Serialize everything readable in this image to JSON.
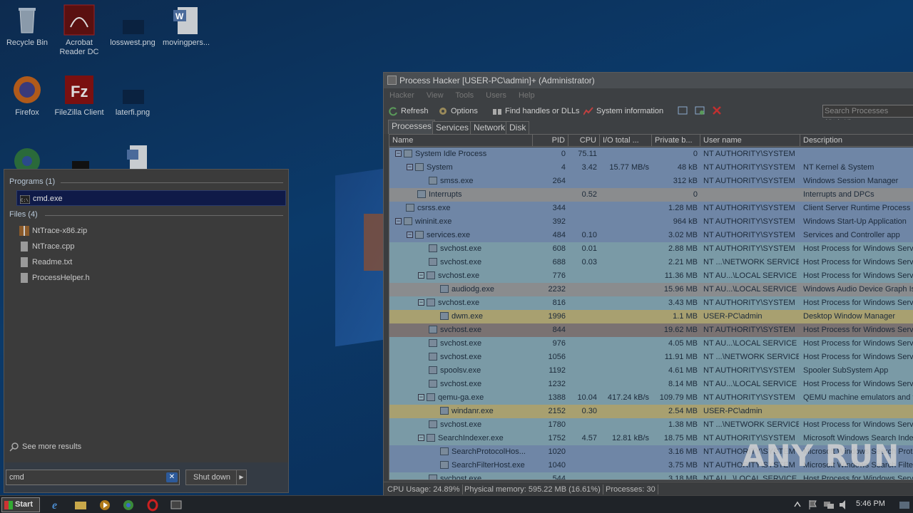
{
  "desktop": {
    "icons": [
      {
        "label": "Recycle Bin",
        "icon": "recycle-bin-icon"
      },
      {
        "label": "Acrobat Reader DC",
        "icon": "acrobat-icon"
      },
      {
        "label": "losswest.png",
        "icon": "image-file-icon"
      },
      {
        "label": "movingpers...",
        "icon": "word-doc-icon"
      },
      {
        "label": "Firefox",
        "icon": "firefox-icon"
      },
      {
        "label": "FileZilla Client",
        "icon": "filezilla-icon"
      },
      {
        "label": "laterfi.png",
        "icon": "image-file-icon"
      }
    ]
  },
  "start_menu": {
    "programs_header": "Programs (1)",
    "programs": [
      {
        "label": "cmd.exe",
        "icon": "cmd-icon"
      }
    ],
    "files_header": "Files (4)",
    "files": [
      {
        "label": "NtTrace-x86.zip",
        "icon": "zip-icon"
      },
      {
        "label": "NtTrace.cpp",
        "icon": "file-icon"
      },
      {
        "label": "Readme.txt",
        "icon": "file-icon"
      },
      {
        "label": "ProcessHelper.h",
        "icon": "file-icon"
      }
    ],
    "see_more": "See more results",
    "search_value": "cmd",
    "shutdown_label": "Shut down"
  },
  "process_hacker": {
    "title": "Process Hacker [USER-PC\\admin]+ (Administrator)",
    "menu": [
      "Hacker",
      "View",
      "Tools",
      "Users",
      "Help"
    ],
    "toolbar": {
      "refresh": "Refresh",
      "options": "Options",
      "find_handles": "Find handles or DLLs",
      "system_info": "System information",
      "search_placeholder": "Search Processes (Ctrl+K)"
    },
    "tabs": [
      "Processes",
      "Services",
      "Network",
      "Disk"
    ],
    "columns": [
      "Name",
      "PID",
      "CPU",
      "I/O total ...",
      "Private b...",
      "User name",
      "Description"
    ],
    "rows": [
      {
        "name": "System Idle Process",
        "pid": "0",
        "cpu": "75.11",
        "io": "",
        "priv": "0",
        "user": "NT AUTHORITY\\SYSTEM",
        "desc": "",
        "level": 0,
        "toggle": "−",
        "color": "#6f86a6"
      },
      {
        "name": "System",
        "pid": "4",
        "cpu": "3.42",
        "io": "15.77 MB/s",
        "priv": "48 kB",
        "user": "NT AUTHORITY\\SYSTEM",
        "desc": "NT Kernel & System",
        "level": 1,
        "toggle": "−",
        "color": "#6f86a6"
      },
      {
        "name": "smss.exe",
        "pid": "264",
        "cpu": "",
        "io": "",
        "priv": "312 kB",
        "user": "NT AUTHORITY\\SYSTEM",
        "desc": "Windows Session Manager",
        "level": 2,
        "toggle": "",
        "color": "#6f86a6"
      },
      {
        "name": "Interrupts",
        "pid": "",
        "cpu": "0.52",
        "io": "",
        "priv": "0",
        "user": "",
        "desc": "Interrupts and DPCs",
        "level": 1,
        "toggle": "",
        "color": "#8a8c8e"
      },
      {
        "name": "csrss.exe",
        "pid": "344",
        "cpu": "",
        "io": "",
        "priv": "1.28 MB",
        "user": "NT AUTHORITY\\SYSTEM",
        "desc": "Client Server Runtime Process",
        "level": 0,
        "toggle": "",
        "color": "#6f86a6"
      },
      {
        "name": "wininit.exe",
        "pid": "392",
        "cpu": "",
        "io": "",
        "priv": "964 kB",
        "user": "NT AUTHORITY\\SYSTEM",
        "desc": "Windows Start-Up Application",
        "level": 0,
        "toggle": "−",
        "color": "#6f86a6"
      },
      {
        "name": "services.exe",
        "pid": "484",
        "cpu": "0.10",
        "io": "",
        "priv": "3.02 MB",
        "user": "NT AUTHORITY\\SYSTEM",
        "desc": "Services and Controller app",
        "level": 1,
        "toggle": "−",
        "color": "#6f86a6"
      },
      {
        "name": "svchost.exe",
        "pid": "608",
        "cpu": "0.01",
        "io": "",
        "priv": "2.88 MB",
        "user": "NT AUTHORITY\\SYSTEM",
        "desc": "Host Process for Windows Servi",
        "level": 2,
        "toggle": "",
        "color": "#7a9aa6"
      },
      {
        "name": "svchost.exe",
        "pid": "688",
        "cpu": "0.03",
        "io": "",
        "priv": "2.21 MB",
        "user": "NT ...\\NETWORK SERVICE",
        "desc": "Host Process for Windows Servi",
        "level": 2,
        "toggle": "",
        "color": "#7a9aa6"
      },
      {
        "name": "svchost.exe",
        "pid": "776",
        "cpu": "",
        "io": "",
        "priv": "11.36 MB",
        "user": "NT AU...\\LOCAL SERVICE",
        "desc": "Host Process for Windows Servi",
        "level": 2,
        "toggle": "−",
        "color": "#7a9aa6"
      },
      {
        "name": "audiodg.exe",
        "pid": "2232",
        "cpu": "",
        "io": "",
        "priv": "15.96 MB",
        "user": "NT AU...\\LOCAL SERVICE",
        "desc": "Windows Audio Device Graph Is",
        "level": 3,
        "toggle": "",
        "color": "#8a8c8e"
      },
      {
        "name": "svchost.exe",
        "pid": "816",
        "cpu": "",
        "io": "",
        "priv": "3.43 MB",
        "user": "NT AUTHORITY\\SYSTEM",
        "desc": "Host Process for Windows Servi",
        "level": 2,
        "toggle": "−",
        "color": "#7a9aa6"
      },
      {
        "name": "dwm.exe",
        "pid": "1996",
        "cpu": "",
        "io": "",
        "priv": "1.1 MB",
        "user": "USER-PC\\admin",
        "desc": "Desktop Window Manager",
        "level": 3,
        "toggle": "",
        "color": "#a8a070"
      },
      {
        "name": "svchost.exe",
        "pid": "844",
        "cpu": "",
        "io": "",
        "priv": "19.62 MB",
        "user": "NT AUTHORITY\\SYSTEM",
        "desc": "Host Process for Windows Servi",
        "level": 2,
        "toggle": "",
        "color": "#7a7272"
      },
      {
        "name": "svchost.exe",
        "pid": "976",
        "cpu": "",
        "io": "",
        "priv": "4.05 MB",
        "user": "NT AU...\\LOCAL SERVICE",
        "desc": "Host Process for Windows Servi",
        "level": 2,
        "toggle": "",
        "color": "#7a9aa6"
      },
      {
        "name": "svchost.exe",
        "pid": "1056",
        "cpu": "",
        "io": "",
        "priv": "11.91 MB",
        "user": "NT ...\\NETWORK SERVICE",
        "desc": "Host Process for Windows Servi",
        "level": 2,
        "toggle": "",
        "color": "#7a9aa6"
      },
      {
        "name": "spoolsv.exe",
        "pid": "1192",
        "cpu": "",
        "io": "",
        "priv": "4.61 MB",
        "user": "NT AUTHORITY\\SYSTEM",
        "desc": "Spooler SubSystem App",
        "level": 2,
        "toggle": "",
        "color": "#7a9aa6"
      },
      {
        "name": "svchost.exe",
        "pid": "1232",
        "cpu": "",
        "io": "",
        "priv": "8.14 MB",
        "user": "NT AU...\\LOCAL SERVICE",
        "desc": "Host Process for Windows Servi",
        "level": 2,
        "toggle": "",
        "color": "#7a9aa6"
      },
      {
        "name": "qemu-ga.exe",
        "pid": "1388",
        "cpu": "10.04",
        "io": "417.24 kB/s",
        "priv": "109.79 MB",
        "user": "NT AUTHORITY\\SYSTEM",
        "desc": "QEMU machine emulators and to",
        "level": 2,
        "toggle": "−",
        "color": "#7a9aa6"
      },
      {
        "name": "windanr.exe",
        "pid": "2152",
        "cpu": "0.30",
        "io": "",
        "priv": "2.54 MB",
        "user": "USER-PC\\admin",
        "desc": "",
        "level": 3,
        "toggle": "",
        "color": "#a8a070"
      },
      {
        "name": "svchost.exe",
        "pid": "1780",
        "cpu": "",
        "io": "",
        "priv": "1.38 MB",
        "user": "NT ...\\NETWORK SERVICE",
        "desc": "Host Process for Windows Servi",
        "level": 2,
        "toggle": "",
        "color": "#7a9aa6"
      },
      {
        "name": "SearchIndexer.exe",
        "pid": "1752",
        "cpu": "4.57",
        "io": "12.81 kB/s",
        "priv": "18.75 MB",
        "user": "NT AUTHORITY\\SYSTEM",
        "desc": "Microsoft Windows Search Index",
        "level": 2,
        "toggle": "−",
        "color": "#7a9aa6"
      },
      {
        "name": "SearchProtocolHos...",
        "pid": "1020",
        "cpu": "",
        "io": "",
        "priv": "3.16 MB",
        "user": "NT AUTHORITY\\SYSTEM",
        "desc": "Microsoft Windows Search Proto",
        "level": 3,
        "toggle": "",
        "color": "#6f86a6"
      },
      {
        "name": "SearchFilterHost.exe",
        "pid": "1040",
        "cpu": "",
        "io": "",
        "priv": "3.75 MB",
        "user": "NT AUTHORITY\\SYSTEM",
        "desc": "Microsoft Windows Search Filter",
        "level": 3,
        "toggle": "",
        "color": "#6f86a6"
      },
      {
        "name": "svchost.exe",
        "pid": "544",
        "cpu": "",
        "io": "",
        "priv": "3.18 MB",
        "user": "NT AU...\\LOCAL SERVICE",
        "desc": "Host Process for Windows Servi",
        "level": 2,
        "toggle": "",
        "color": "#7a9aa6"
      }
    ],
    "status": {
      "cpu": "CPU Usage: 24.89%",
      "memory": "Physical memory: 595.22 MB (16.61%)",
      "processes": "Processes: 30"
    }
  },
  "taskbar": {
    "start_label": "Start",
    "clock": "5:46 PM",
    "apps": [
      "ie-icon",
      "explorer-icon",
      "media-player-icon",
      "chrome-icon",
      "opera-icon",
      "process-hacker-icon"
    ]
  },
  "watermark": "ANY RUN"
}
